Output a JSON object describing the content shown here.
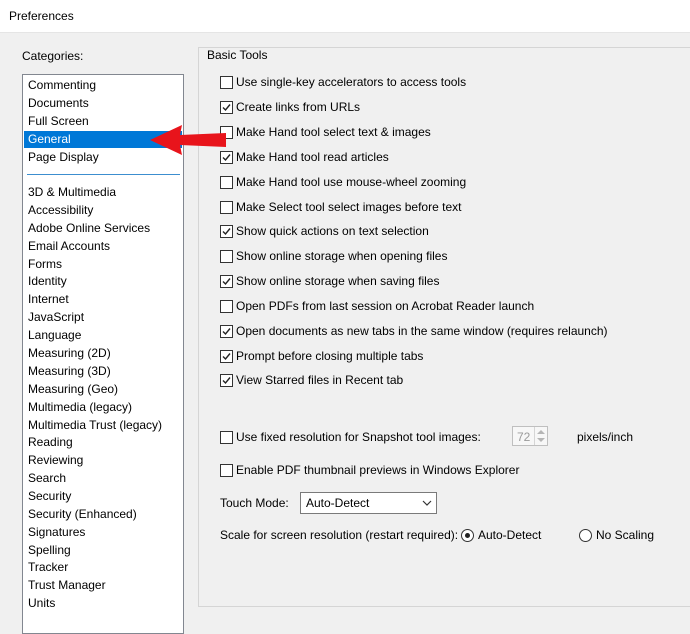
{
  "window": {
    "title": "Preferences"
  },
  "categories": {
    "label": "Categories:",
    "selected": "General",
    "top_items": [
      "Commenting",
      "Documents",
      "Full Screen",
      "General",
      "Page Display"
    ],
    "items": [
      "3D & Multimedia",
      "Accessibility",
      "Adobe Online Services",
      "Email Accounts",
      "Forms",
      "Identity",
      "Internet",
      "JavaScript",
      "Language",
      "Measuring (2D)",
      "Measuring (3D)",
      "Measuring (Geo)",
      "Multimedia (legacy)",
      "Multimedia Trust (legacy)",
      "Reading",
      "Reviewing",
      "Search",
      "Security",
      "Security (Enhanced)",
      "Signatures",
      "Spelling",
      "Tracker",
      "Trust Manager",
      "Units"
    ]
  },
  "basic_tools": {
    "title": "Basic Tools",
    "options": [
      {
        "label": "Use single-key accelerators to access tools",
        "checked": false
      },
      {
        "label": "Create links from URLs",
        "checked": true
      },
      {
        "label": "Make Hand tool select text & images",
        "checked": false
      },
      {
        "label": "Make Hand tool read articles",
        "checked": true
      },
      {
        "label": "Make Hand tool use mouse-wheel zooming",
        "checked": false
      },
      {
        "label": "Make Select tool select images before text",
        "checked": false
      },
      {
        "label": "Show quick actions on text selection",
        "checked": true
      },
      {
        "label": "Show online storage when opening files",
        "checked": false
      },
      {
        "label": "Show online storage when saving files",
        "checked": true
      },
      {
        "label": "Open PDFs from last session on Acrobat Reader launch",
        "checked": false
      },
      {
        "label": "Open documents as new tabs in the same window (requires relaunch)",
        "checked": true
      },
      {
        "label": "Prompt before closing multiple tabs",
        "checked": true
      },
      {
        "label": "View Starred files in Recent tab",
        "checked": true
      }
    ]
  },
  "snapshot": {
    "label": "Use fixed resolution for Snapshot tool images:",
    "checked": false,
    "value": "72",
    "unit": "pixels/inch"
  },
  "thumbnail": {
    "label": "Enable PDF thumbnail previews in Windows Explorer",
    "checked": false
  },
  "touch_mode": {
    "label": "Touch Mode:",
    "value": "Auto-Detect"
  },
  "scale": {
    "label": "Scale for screen resolution (restart required):",
    "options": [
      {
        "label": "Auto-Detect",
        "selected": true
      },
      {
        "label": "No Scaling",
        "selected": false
      }
    ]
  },
  "colors": {
    "selection": "#0078d7",
    "annotation_arrow": "#e8141b"
  }
}
